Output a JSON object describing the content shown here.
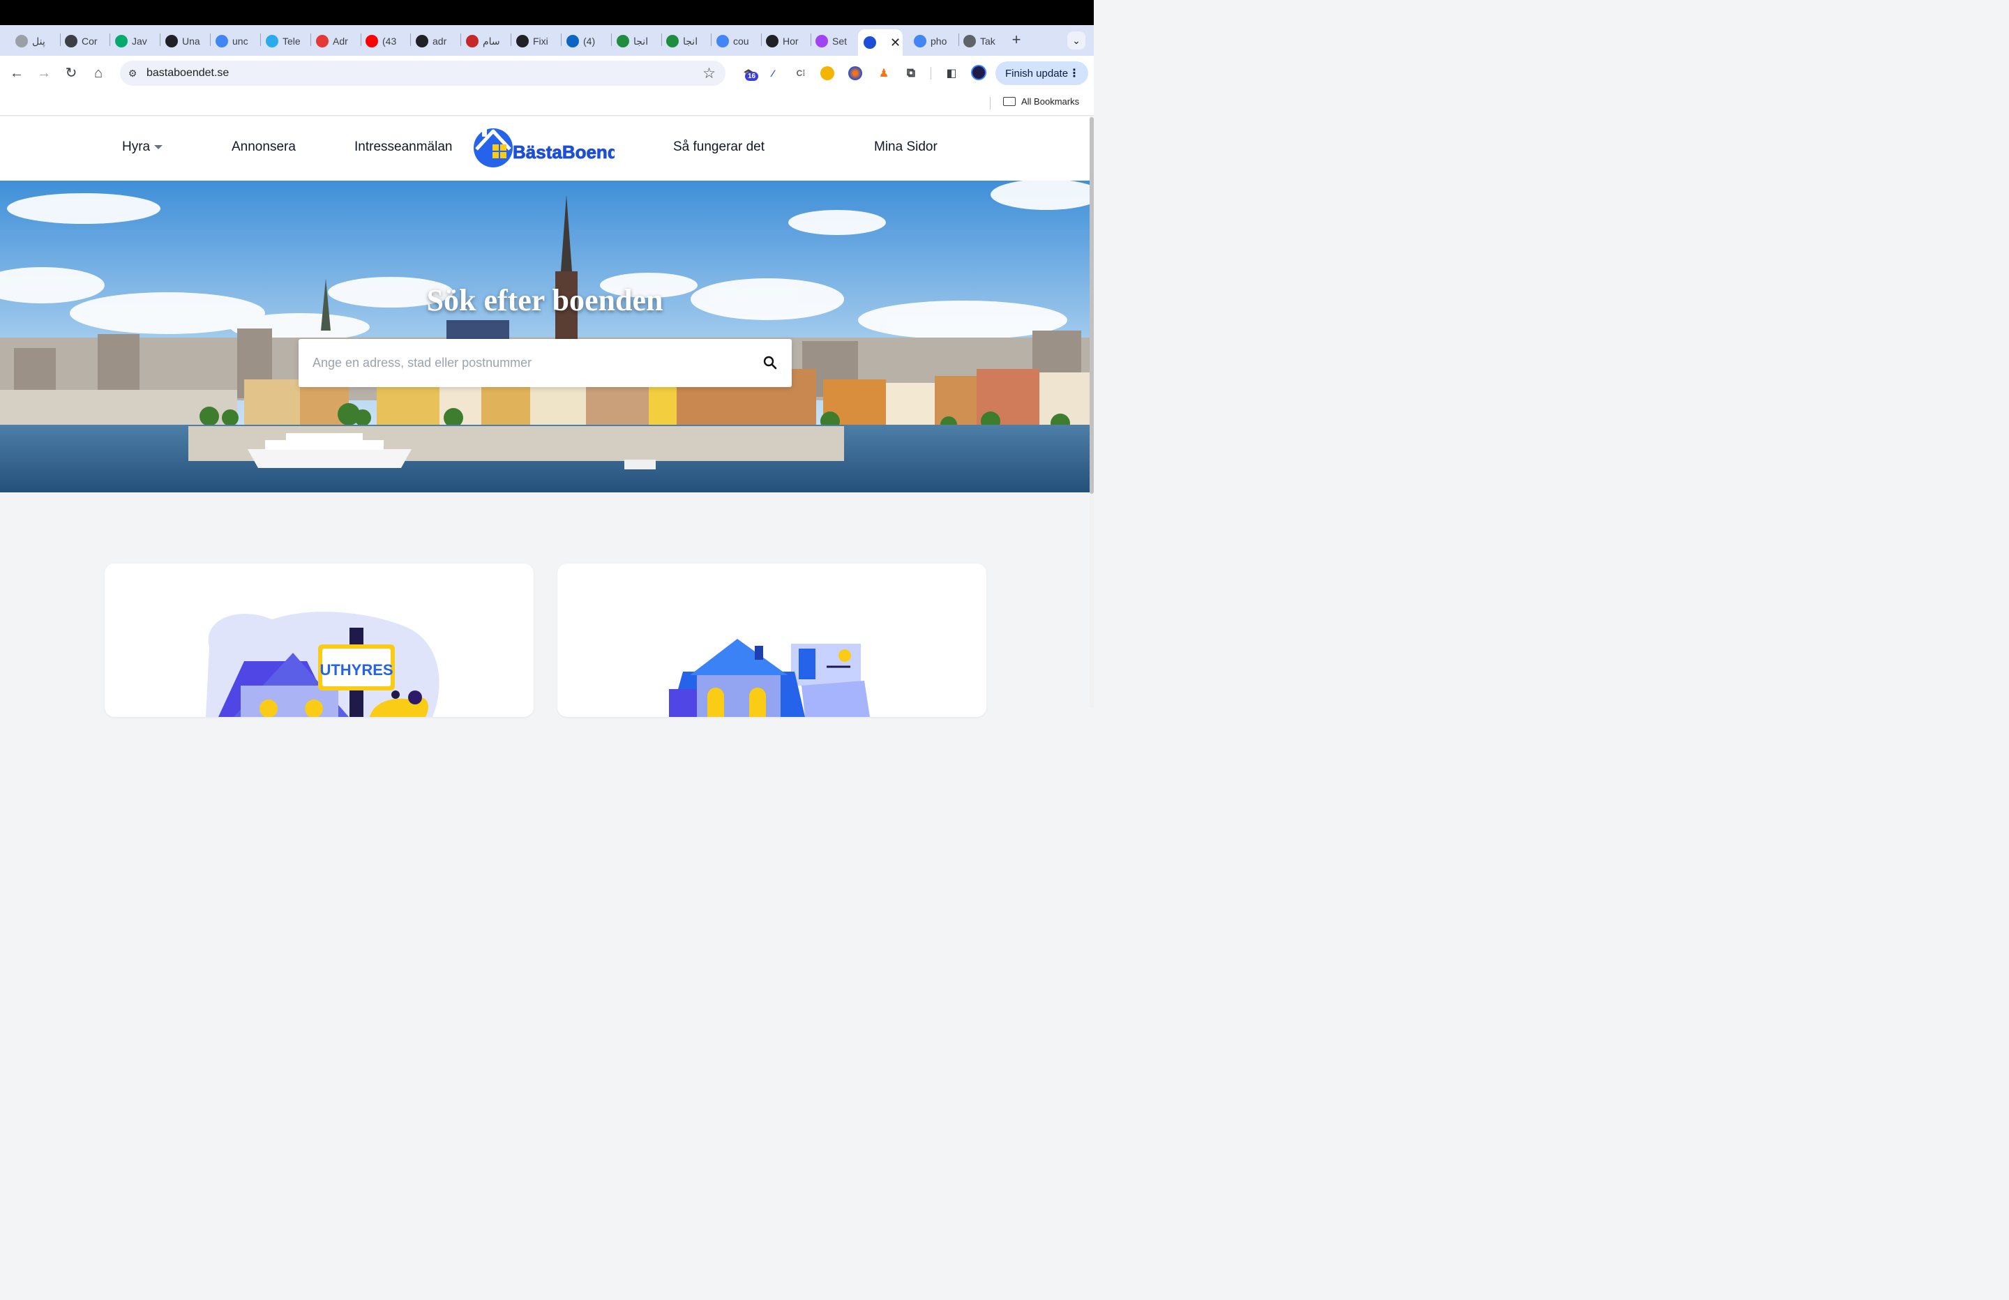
{
  "browser": {
    "tabs": [
      {
        "label": "پنل",
        "icon": "globe-icon",
        "color": "#9aa0a6"
      },
      {
        "label": "Cor",
        "icon": "react-icon",
        "color": "#3c4043"
      },
      {
        "label": "Jav",
        "icon": "w3-icon",
        "color": "#04aa6d"
      },
      {
        "label": "Una",
        "icon": "bracket-icon",
        "color": "#202124"
      },
      {
        "label": "unc",
        "icon": "google-icon",
        "color": "#4285f4"
      },
      {
        "label": "Tele",
        "icon": "telegram-icon",
        "color": "#2aabee"
      },
      {
        "label": "Adr",
        "icon": "adr-icon",
        "color": "#e53935"
      },
      {
        "label": "(43",
        "icon": "youtube-icon",
        "color": "#ff0000"
      },
      {
        "label": "adr",
        "icon": "github-icon",
        "color": "#202124"
      },
      {
        "label": "سام",
        "icon": "emblem-icon",
        "color": "#c62828"
      },
      {
        "label": "Fixi",
        "icon": "openai-icon",
        "color": "#202124"
      },
      {
        "label": "(4)",
        "icon": "linkedin-icon",
        "color": "#0a66c2"
      },
      {
        "label": "انجا",
        "icon": "book-icon",
        "color": "#1e8e3e"
      },
      {
        "label": "انجا",
        "icon": "book-icon",
        "color": "#1e8e3e"
      },
      {
        "label": "cou",
        "icon": "google-icon",
        "color": "#4285f4"
      },
      {
        "label": "Hor",
        "icon": "crest-icon",
        "color": "#202124"
      },
      {
        "label": "Set",
        "icon": "setting-spark-icon",
        "color": "#a142f4"
      },
      {
        "label": "",
        "icon": "bastaboendet-icon",
        "color": "#1d4ed8"
      },
      {
        "label": "pho",
        "icon": "google-icon",
        "color": "#4285f4"
      },
      {
        "label": "Tak",
        "icon": "apple-icon",
        "color": "#5f6368"
      }
    ],
    "url": "bastaboendet.se",
    "extension_badge": "16",
    "finish_update": "Finish update",
    "all_bookmarks": "All Bookmarks"
  },
  "site": {
    "nav": {
      "rent": "Hyra",
      "advertise": "Annonsera",
      "interest": "Intresseanmälan",
      "how": "Så fungerar det",
      "my_pages": "Mina Sidor"
    },
    "logo_text": "BästaBoendet",
    "hero": {
      "title": "Sök efter boenden",
      "search_placeholder": "Ange en adress, stad eller postnummer"
    },
    "cards": [
      {
        "sign_text": "UTHYRES"
      },
      {
        "illustration": "house-with-rooms"
      }
    ],
    "colors": {
      "brand_blue": "#1d4ed8",
      "brand_yellow": "#facc15",
      "page_bg": "#f3f4f6"
    }
  }
}
